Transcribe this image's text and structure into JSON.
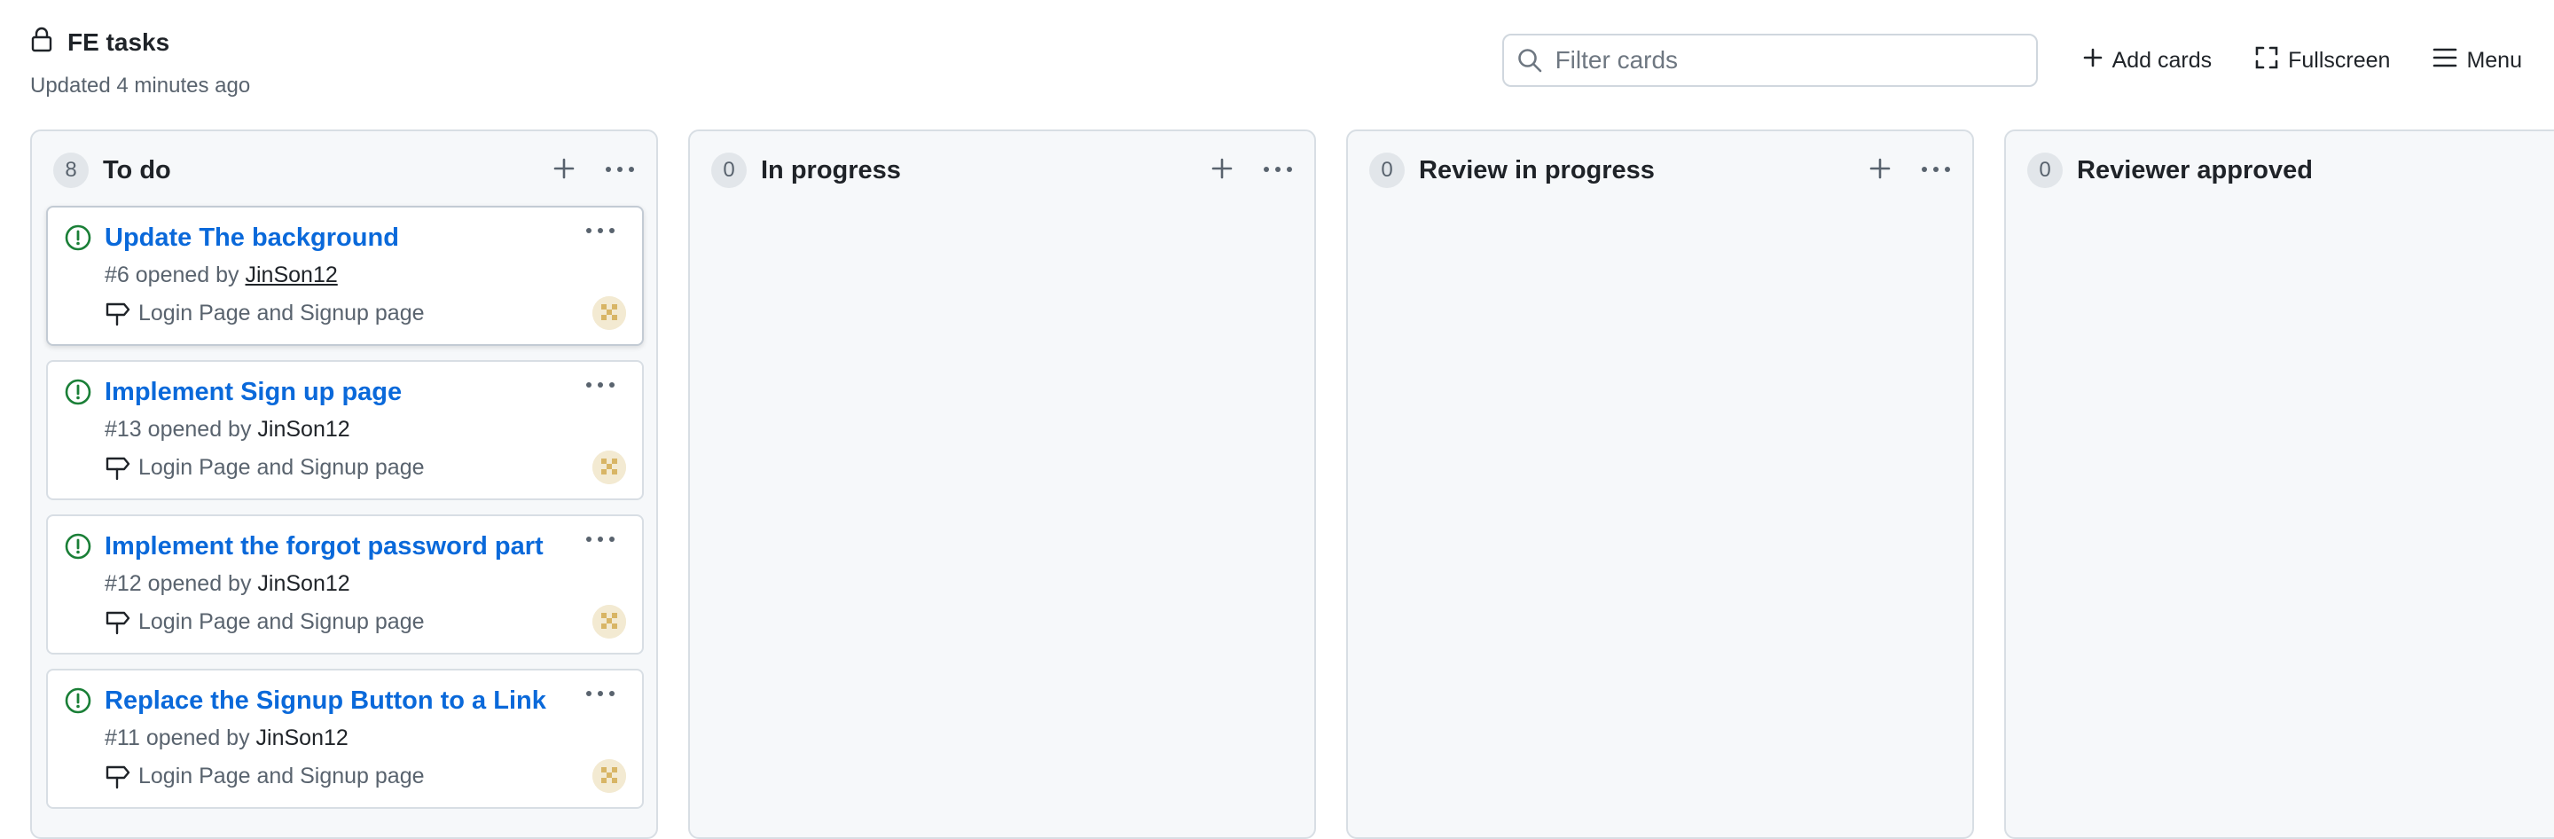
{
  "project": {
    "title": "FE tasks",
    "updated": "Updated 4 minutes ago",
    "lock_icon": "lock-icon"
  },
  "toolbar": {
    "filter_placeholder": "Filter cards",
    "add_cards": "Add cards",
    "fullscreen": "Fullscreen",
    "menu": "Menu"
  },
  "columns": [
    {
      "count": "8",
      "title": "To do",
      "cards": [
        {
          "title": "Update The background",
          "number": "#6",
          "opened_by": "opened by",
          "author": "JinSon12",
          "milestone": "Login Page and Signup page"
        },
        {
          "title": "Implement Sign up page",
          "number": "#13",
          "opened_by": "opened by",
          "author": "JinSon12",
          "milestone": "Login Page and Signup page"
        },
        {
          "title": "Implement the forgot password part",
          "number": "#12",
          "opened_by": "opened by",
          "author": "JinSon12",
          "milestone": "Login Page and Signup page"
        },
        {
          "title": "Replace the Signup Button to a Link",
          "number": "#11",
          "opened_by": "opened by",
          "author": "JinSon12",
          "milestone": "Login Page and Signup page"
        }
      ]
    },
    {
      "count": "0",
      "title": "In progress"
    },
    {
      "count": "0",
      "title": "Review in progress"
    },
    {
      "count": "0",
      "title": "Reviewer approved"
    }
  ],
  "colors": {
    "link": "#0a69da",
    "issue_open": "#1a7f37",
    "column_bg": "#f6f8fa"
  }
}
